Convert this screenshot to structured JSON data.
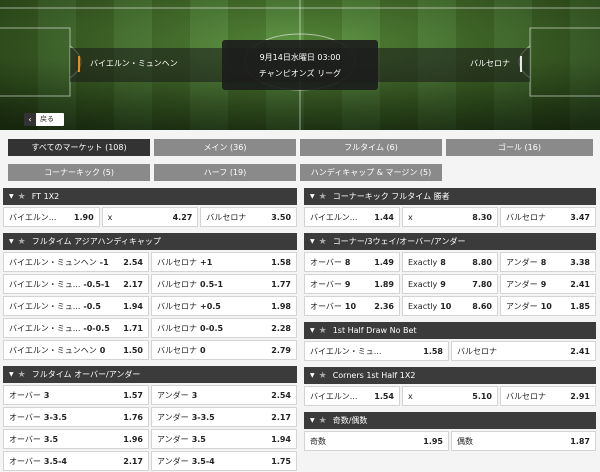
{
  "match": {
    "home": "バイエルン・ミュンヘン",
    "away": "バルセロナ",
    "datetime": "9月14日水曜日 03:00",
    "competition": "チャンピオンズ リーグ",
    "back_label": "戻る",
    "home_color": "#f08a1c",
    "away_color": "#e8e8e8"
  },
  "filters": [
    {
      "label": "すべてのマーケット (108)",
      "active": true
    },
    {
      "label": "メイン (36)",
      "active": false
    },
    {
      "label": "フルタイム (6)",
      "active": false
    },
    {
      "label": "ゴール (16)",
      "active": false
    },
    {
      "label": "コーナーキック (5)",
      "active": false
    },
    {
      "label": "ハーフ (19)",
      "active": false
    },
    {
      "label": "ハンディキャップ & マージン (5)",
      "active": false
    }
  ],
  "markets_left": [
    {
      "title": "FT 1X2",
      "rows": [
        [
          {
            "label": "バイエルン...",
            "odd": "1.90"
          },
          {
            "label": "x",
            "odd": "4.27"
          },
          {
            "label": "バルセロナ",
            "odd": "3.50"
          }
        ]
      ]
    },
    {
      "title": "フルタイム アジアハンディキャップ",
      "rows": [
        [
          {
            "label": "バイエルン・ミュンヘン",
            "hc": "-1",
            "odd": "2.54"
          },
          {
            "label": "バルセロナ",
            "hc": "+1",
            "odd": "1.58"
          }
        ],
        [
          {
            "label": "バイエルン・ミュ...",
            "hc": "-0.5-1",
            "odd": "2.17"
          },
          {
            "label": "バルセロナ",
            "hc": "0.5-1",
            "odd": "1.77"
          }
        ],
        [
          {
            "label": "バイエルン・ミュ...",
            "hc": "-0.5",
            "odd": "1.94"
          },
          {
            "label": "バルセロナ",
            "hc": "+0.5",
            "odd": "1.98"
          }
        ],
        [
          {
            "label": "バイエルン・ミュ...",
            "hc": "-0-0.5",
            "odd": "1.71"
          },
          {
            "label": "バルセロナ",
            "hc": "0-0.5",
            "odd": "2.28"
          }
        ],
        [
          {
            "label": "バイエルン・ミュンヘン",
            "hc": "0",
            "odd": "1.50"
          },
          {
            "label": "バルセロナ",
            "hc": "0",
            "odd": "2.79"
          }
        ]
      ]
    },
    {
      "title": "フルタイム オーバー/アンダー",
      "rows": [
        [
          {
            "label": "オーバー",
            "hc": "3",
            "odd": "1.57"
          },
          {
            "label": "アンダー",
            "hc": "3",
            "odd": "2.54"
          }
        ],
        [
          {
            "label": "オーバー",
            "hc": "3-3.5",
            "odd": "1.76"
          },
          {
            "label": "アンダー",
            "hc": "3-3.5",
            "odd": "2.17"
          }
        ],
        [
          {
            "label": "オーバー",
            "hc": "3.5",
            "odd": "1.96"
          },
          {
            "label": "アンダー",
            "hc": "3.5",
            "odd": "1.94"
          }
        ],
        [
          {
            "label": "オーバー",
            "hc": "3.5-4",
            "odd": "2.17"
          },
          {
            "label": "アンダー",
            "hc": "3.5-4",
            "odd": "1.75"
          }
        ]
      ]
    }
  ],
  "markets_right": [
    {
      "title": "コーナーキック フルタイム 勝者",
      "rows": [
        [
          {
            "label": "バイエルン...",
            "odd": "1.44"
          },
          {
            "label": "x",
            "odd": "8.30"
          },
          {
            "label": "バルセロナ",
            "odd": "3.47"
          }
        ]
      ]
    },
    {
      "title": "コーナー/3ウェイ/オーバー/アンダー",
      "rows": [
        [
          {
            "label": "オーバー",
            "hc": "8",
            "odd": "1.49"
          },
          {
            "label": "Exactly",
            "hc": "8",
            "odd": "8.80"
          },
          {
            "label": "アンダー",
            "hc": "8",
            "odd": "3.38"
          }
        ],
        [
          {
            "label": "オーバー",
            "hc": "9",
            "odd": "1.89"
          },
          {
            "label": "Exactly",
            "hc": "9",
            "odd": "7.80"
          },
          {
            "label": "アンダー",
            "hc": "9",
            "odd": "2.41"
          }
        ],
        [
          {
            "label": "オーバー",
            "hc": "10",
            "odd": "2.36"
          },
          {
            "label": "Exactly",
            "hc": "10",
            "odd": "8.60"
          },
          {
            "label": "アンダー",
            "hc": "10",
            "odd": "1.85"
          }
        ]
      ]
    },
    {
      "title": "1st Half Draw No Bet",
      "rows": [
        [
          {
            "label": "バイエルン・ミュ...",
            "odd": "1.58"
          },
          {
            "label": "バルセロナ",
            "odd": "2.41"
          }
        ]
      ]
    },
    {
      "title": "Corners 1st Half 1X2",
      "rows": [
        [
          {
            "label": "バイエルン...",
            "odd": "1.54"
          },
          {
            "label": "x",
            "odd": "5.10"
          },
          {
            "label": "バルセロナ",
            "odd": "2.91"
          }
        ]
      ]
    },
    {
      "title": "奇数/偶数",
      "rows": [
        [
          {
            "label": "奇数",
            "odd": "1.95"
          },
          {
            "label": "偶数",
            "odd": "1.87"
          }
        ]
      ]
    }
  ]
}
